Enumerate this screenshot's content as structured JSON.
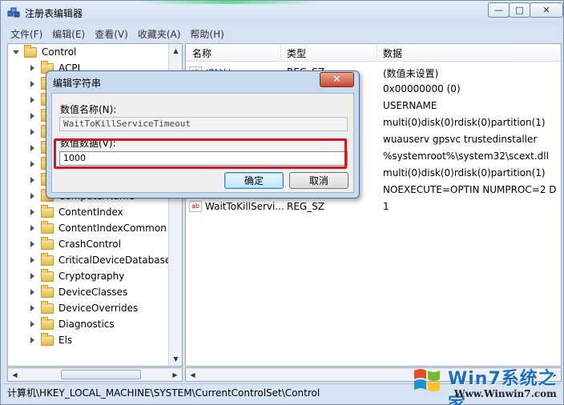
{
  "window": {
    "title": "注册表编辑器",
    "min_label": "—",
    "max_label": "□",
    "close_label": "✕"
  },
  "menu": [
    "文件(F)",
    "编辑(E)",
    "查看(V)",
    "收藏夹(A)",
    "帮助(H)"
  ],
  "tree": {
    "root": "Control",
    "items": [
      "ACPI",
      "",
      "",
      "",
      "",
      "",
      "",
      "",
      "ComputerName",
      "ContentIndex",
      "ContentIndexCommon",
      "CrashControl",
      "CriticalDeviceDatabase",
      "Cryptography",
      "DeviceClasses",
      "DeviceOverrides",
      "Diagnostics",
      "Els"
    ]
  },
  "list": {
    "columns": [
      "名称",
      "类型",
      "数据"
    ],
    "rows": [
      {
        "name": "(默认)",
        "type": "REG_SZ",
        "data": "(数值未设置)"
      },
      {
        "name": "",
        "type": "",
        "data": "0x00000000 (0)"
      },
      {
        "name": "",
        "type": "",
        "data": "USERNAME"
      },
      {
        "name": "",
        "type": "",
        "data": "multi(0)disk(0)rdisk(0)partition(1)"
      },
      {
        "name": "",
        "type": "",
        "data": "wuauserv gpsvc trustedinstaller"
      },
      {
        "name": "",
        "type": "Z",
        "data": "%systemroot%\\system32\\scext.dll"
      },
      {
        "name": "",
        "type": "",
        "data": "multi(0)disk(0)rdisk(0)partition(1)"
      },
      {
        "name": "",
        "type": "",
        "data": " NOEXECUTE=OPTIN  NUMPROC=2 D"
      },
      {
        "name": "WaitToKillServi...",
        "type": "REG_SZ",
        "data": "1"
      }
    ]
  },
  "status": "计算机\\HKEY_LOCAL_MACHINE\\SYSTEM\\CurrentControlSet\\Control",
  "dialog": {
    "title": "编辑字符串",
    "close_label": "✕",
    "name_label": "数值名称(N):",
    "name_value": "WaitToKillServiceTimeout",
    "data_label": "数值数据(V):",
    "data_value": "1000",
    "ok": "确定",
    "cancel": "取消"
  },
  "watermark": {
    "brand": "Win7系统之家",
    "url": "Www.Winwin7.com"
  },
  "colors": {
    "highlight_box": "#d8141c",
    "window_frame": "#d6e3f2"
  }
}
